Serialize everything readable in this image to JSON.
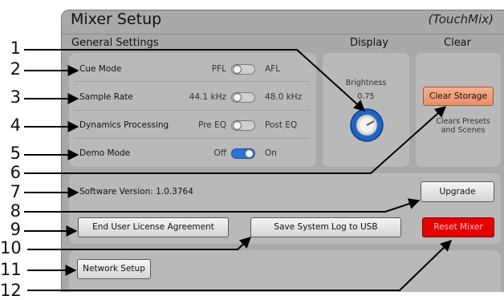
{
  "window": {
    "title": "Mixer Setup",
    "brand": "(TouchMix)"
  },
  "sections": {
    "general": "General Settings",
    "display": "Display",
    "clear": "Clear"
  },
  "settings": [
    {
      "label": "Cue Mode",
      "option_off": "PFL",
      "option_on": "AFL",
      "state": "off"
    },
    {
      "label": "Sample Rate",
      "option_off": "44.1 kHz",
      "option_on": "48.0 kHz",
      "state": "off"
    },
    {
      "label": "Dynamics Processing",
      "option_off": "Pre EQ",
      "option_on": "Post EQ",
      "state": "off"
    },
    {
      "label": "Demo Mode",
      "option_off": "Off",
      "option_on": "On",
      "state": "on"
    }
  ],
  "display": {
    "label": "Brightness",
    "value": "0.75"
  },
  "clear": {
    "button": "Clear Storage",
    "note": "Clears Presets and Scenes"
  },
  "software": {
    "version_text": "Software Version: 1.0.3764",
    "upgrade_button": "Upgrade"
  },
  "buttons": {
    "eula": "End User License Agreement",
    "save_log": "Save System Log to USB",
    "reset": "Reset Mixer",
    "network": "Network Setup"
  },
  "callout_numbers": [
    "1",
    "2",
    "3",
    "4",
    "5",
    "6",
    "7",
    "8",
    "9",
    "10",
    "11",
    "12"
  ],
  "colors": {
    "accent_blue": "#2d73d6",
    "clear_orange": "#e98f66",
    "reset_red": "#e50000"
  }
}
